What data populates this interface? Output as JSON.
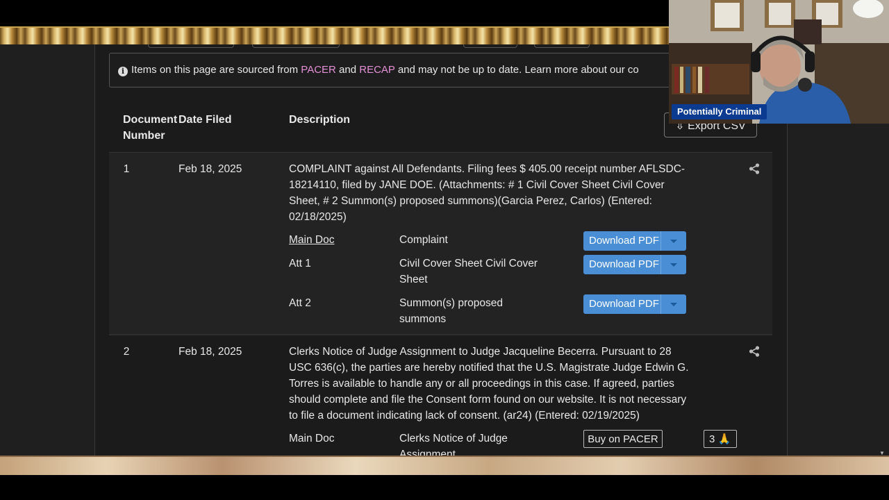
{
  "notice": {
    "parts": [
      "Items on this page are sourced from ",
      "PACER",
      " and ",
      "RECAP",
      " and may not be up to date. Learn more about our co"
    ]
  },
  "table": {
    "headers": {
      "doc_number_line1": "Document",
      "doc_number_line2": "Number",
      "date_filed": "Date Filed",
      "description": "Description"
    },
    "export_label": "Export CSV"
  },
  "entries": [
    {
      "number": "1",
      "date": "Feb 18, 2025",
      "description_lines": [
        "COMPLAINT against All Defendants. Filing fees $ 405.00 receipt number AFLSDC-",
        "18214110, filed by JANE DOE. (Attachments: # 1 Civil Cover Sheet Civil Cover",
        "Sheet, # 2 Summon(s) proposed summons)(Garcia Perez, Carlos) (Entered:",
        "02/18/2025)"
      ],
      "docs": [
        {
          "label": "Main Doc",
          "desc_lines": [
            "Complaint"
          ],
          "button": "Download PDF"
        },
        {
          "label": "Att 1",
          "desc_lines": [
            "Civil Cover Sheet Civil Cover",
            "Sheet"
          ],
          "button": "Download PDF"
        },
        {
          "label": "Att 2",
          "desc_lines": [
            "Summon(s) proposed",
            "summons"
          ],
          "button": "Download PDF"
        }
      ]
    },
    {
      "number": "2",
      "date": "Feb 18, 2025",
      "description_lines": [
        "Clerks Notice of Judge Assignment to Judge Jacqueline Becerra. Pursuant to 28",
        "USC 636(c), the parties are hereby notified that the U.S. Magistrate Judge Edwin G.",
        "Torres is available to handle any or all proceedings in this case. If agreed, parties",
        "should complete and file the Consent form found on our website. It is not necessary",
        "to file a document indicating lack of consent. (ar24) (Entered: 02/19/2025)"
      ],
      "docs": [
        {
          "label": "Main Doc",
          "desc_lines": [
            "Clerks Notice of Judge",
            "Assignment"
          ],
          "button": "Buy on PACER",
          "count": "3 🙏"
        }
      ]
    }
  ],
  "webcam": {
    "label": "Potentially Criminal"
  },
  "colors": {
    "link": "#e48fd6",
    "download": "#4a8fd6",
    "label_bg": "#0b3a91"
  }
}
